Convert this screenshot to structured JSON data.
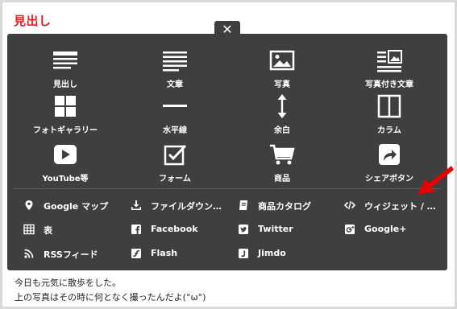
{
  "heading": "見出し",
  "close_glyph": "✕",
  "big_items": [
    {
      "label": "見出し",
      "icon": "heading-icon"
    },
    {
      "label": "文章",
      "icon": "text-icon"
    },
    {
      "label": "写真",
      "icon": "photo-icon"
    },
    {
      "label": "写真付き文章",
      "icon": "photo-text-icon"
    },
    {
      "label": "フォトギャラリー",
      "icon": "gallery-icon"
    },
    {
      "label": "水平線",
      "icon": "horizontal-line-icon"
    },
    {
      "label": "余白",
      "icon": "spacing-icon"
    },
    {
      "label": "カラム",
      "icon": "column-icon"
    },
    {
      "label": "YouTube等",
      "icon": "youtube-icon"
    },
    {
      "label": "フォーム",
      "icon": "form-icon"
    },
    {
      "label": "商品",
      "icon": "cart-icon"
    },
    {
      "label": "シェアボタン",
      "icon": "share-icon"
    }
  ],
  "small_items": [
    {
      "label": "Google マップ",
      "icon": "map-pin-icon"
    },
    {
      "label": "ファイルダウン…",
      "icon": "download-icon"
    },
    {
      "label": "商品カタログ",
      "icon": "catalog-icon"
    },
    {
      "label": "ウィジェット / …",
      "icon": "code-icon"
    },
    {
      "label": "表",
      "icon": "table-icon"
    },
    {
      "label": "Facebook",
      "icon": "facebook-icon"
    },
    {
      "label": "Twitter",
      "icon": "twitter-icon"
    },
    {
      "label": "Google+",
      "icon": "google-plus-icon"
    },
    {
      "label": "RSSフィード",
      "icon": "rss-icon"
    },
    {
      "label": "Flash",
      "icon": "flash-icon"
    },
    {
      "label": "Jimdo",
      "icon": "jimdo-icon"
    }
  ],
  "body_lines": [
    "今日も元気に散歩をした。",
    "上の写真はその時に何となく撮ったんだよ(°ω°)"
  ],
  "colors": {
    "accent": "#e02020",
    "panel": "#3f3f3f",
    "arrow": "#e60000"
  }
}
